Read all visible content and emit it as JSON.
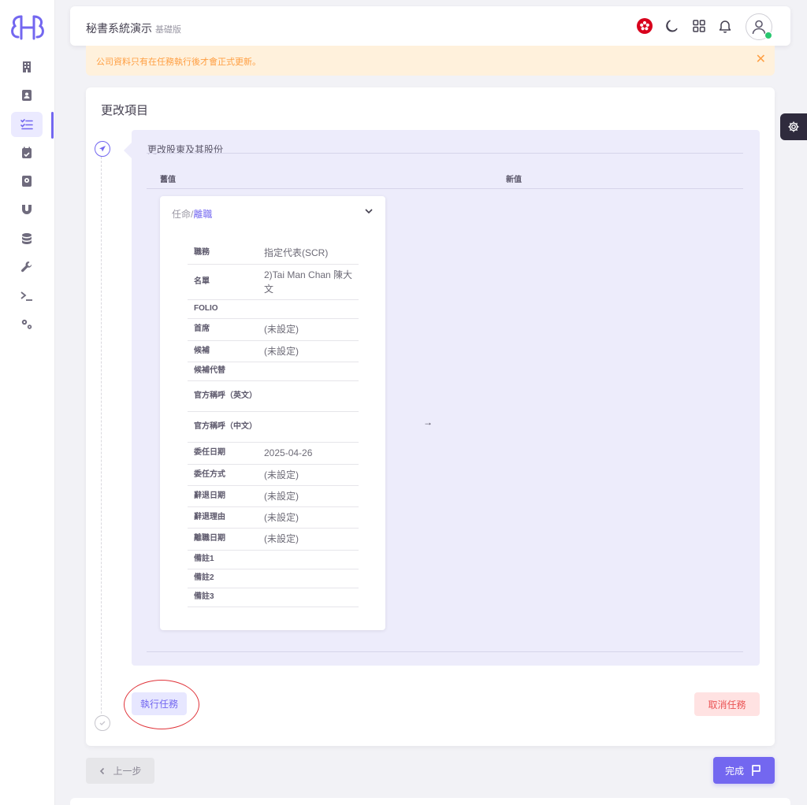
{
  "colors": {
    "primary": "#7367f0",
    "warning": "#ff9f43",
    "danger": "#ea5455",
    "success": "#28c76f"
  },
  "sidebar": {
    "items": [
      {
        "icon": "building-icon",
        "active": false
      },
      {
        "icon": "contacts-book-icon",
        "active": false
      },
      {
        "icon": "task-list-icon",
        "active": true
      },
      {
        "icon": "calendar-check-icon",
        "active": false
      },
      {
        "icon": "record-book-icon",
        "active": false
      },
      {
        "icon": "magnet-icon",
        "active": false
      },
      {
        "icon": "database-icon",
        "active": false
      },
      {
        "icon": "wrench-icon",
        "active": false
      },
      {
        "icon": "terminal-icon",
        "active": false
      },
      {
        "icon": "cogs-icon",
        "active": false
      }
    ]
  },
  "header": {
    "title": "秘書系統演示",
    "edition": "基礎版",
    "icons": [
      "hong-kong-flag-icon",
      "moon-icon",
      "grid-icon",
      "bell-icon",
      "user-avatar-icon"
    ]
  },
  "alert": {
    "text": "公司資料只有在任務執行後才會正式更新。",
    "close": "✕"
  },
  "card": {
    "title": "更改項目",
    "section_title": "更改股東及其股份",
    "col_old": "舊值",
    "col_new": "新值",
    "arrow": "→",
    "detail": {
      "heading_prefix": "任命/",
      "heading_main": "離職",
      "rows": [
        {
          "key": "職務",
          "value": "指定代表(SCR)"
        },
        {
          "key": "名單",
          "value": "2)Tai Man Chan 陳大文"
        },
        {
          "key": "FOLIO",
          "value": ""
        },
        {
          "key": "首席",
          "value": "(未設定)"
        },
        {
          "key": "候補",
          "value": "(未設定)"
        },
        {
          "key": "候補代替",
          "value": ""
        },
        {
          "key": "官方稱呼（英文）",
          "value": ""
        },
        {
          "key": "官方稱呼（中文）",
          "value": ""
        },
        {
          "key": "委任日期",
          "value": "2025-04-26"
        },
        {
          "key": "委任方式",
          "value": "(未設定)"
        },
        {
          "key": "辭退日期",
          "value": "(未設定)"
        },
        {
          "key": "辭退理由",
          "value": "(未設定)"
        },
        {
          "key": "離職日期",
          "value": "(未設定)"
        },
        {
          "key": "備註1",
          "value": ""
        },
        {
          "key": "備註2",
          "value": ""
        },
        {
          "key": "備註3",
          "value": ""
        }
      ]
    },
    "execute_label": "執行任務",
    "cancel_label": "取消任務"
  },
  "footer": {
    "back_label": "上一步",
    "finish_label": "完成"
  }
}
